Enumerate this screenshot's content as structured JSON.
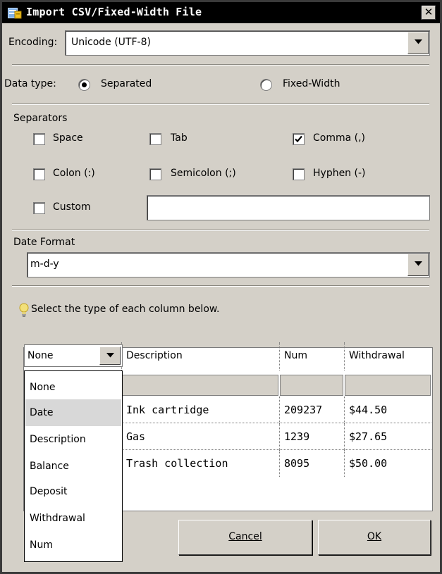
{
  "window": {
    "title": "Import CSV/Fixed-Width File",
    "close_glyph": "✕"
  },
  "encoding": {
    "label": "Encoding:",
    "value": "Unicode (UTF-8)"
  },
  "data_type": {
    "label": "Data type:",
    "options": [
      "Separated",
      "Fixed-Width"
    ],
    "selected": "Separated"
  },
  "separators": {
    "heading": "Separators",
    "items": [
      {
        "label": "Space",
        "checked": false
      },
      {
        "label": "Tab",
        "checked": false
      },
      {
        "label": "Comma (,)",
        "checked": true
      },
      {
        "label": "Colon (:)",
        "checked": false
      },
      {
        "label": "Semicolon (;)",
        "checked": false
      },
      {
        "label": "Hyphen (-)",
        "checked": false
      },
      {
        "label": "Custom",
        "checked": false
      }
    ],
    "custom_value": ""
  },
  "date_format": {
    "heading": "Date Format",
    "value": "m-d-y"
  },
  "columns": {
    "hint": "Select the type of each column below.",
    "selected_type": "None",
    "headers": [
      "Description",
      "Num",
      "Withdrawal"
    ],
    "rows": [
      [
        "Ink cartridge",
        "209237",
        "$44.50"
      ],
      [
        "Gas",
        "1239",
        "$27.65"
      ],
      [
        "Trash collection",
        "8095",
        "$50.00"
      ]
    ],
    "type_options": [
      "None",
      "Date",
      "Description",
      "Balance",
      "Deposit",
      "Withdrawal",
      "Num"
    ],
    "highlighted_option": "Date"
  },
  "buttons": {
    "cancel": "Cancel",
    "ok": "OK"
  },
  "colors": {
    "titlebar": "#000000",
    "dialog_bg": "#d4d0c8",
    "highlight": "#d8d8d8",
    "hint_icon": "#e8d060"
  },
  "icons": [
    "app-icon",
    "close-icon",
    "chevron-down-icon",
    "checkmark-icon",
    "lightbulb-icon"
  ]
}
